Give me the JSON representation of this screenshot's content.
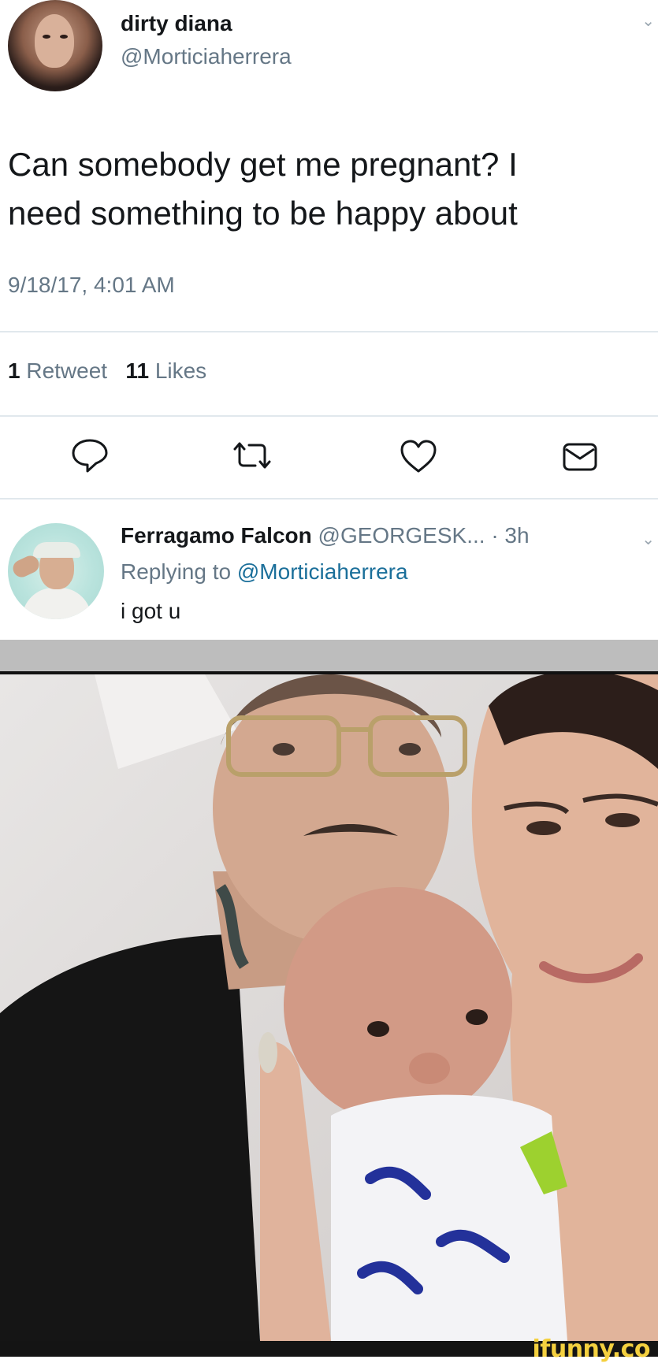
{
  "tweet": {
    "name": "dirty diana",
    "handle": "@Morticiaherrera",
    "text_line1": "Can somebody get me pregnant? I",
    "text_line2": "need something to be happy about",
    "timestamp": "9/18/17, 4:01 AM",
    "retweet_count": "1",
    "retweet_label": "Retweet",
    "like_count": "11",
    "like_label": "Likes"
  },
  "actions": [
    "reply-icon",
    "retweet-icon",
    "heart-icon",
    "message-icon"
  ],
  "reply": {
    "name": "Ferragamo Falcon",
    "handle_meta": "@GEORGESK... · 3h",
    "replying_prefix": "Replying to",
    "replying_mention": "@Morticiaherrera",
    "text": "i got u"
  },
  "watermark": "ifunny.co",
  "colors": {
    "text": "#14171a",
    "muted": "#657786",
    "mention": "#1b6f9a",
    "divider": "#e1e8ed",
    "watermark": "#f4d03f"
  }
}
